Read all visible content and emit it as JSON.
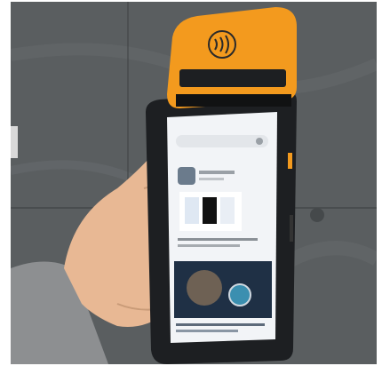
{
  "photo": {
    "subject": "handheld-pos-terminal",
    "colors": {
      "printer_orange": "#f39a1e",
      "device_body": "#1d1f22",
      "wall_tile": "#5a5e60",
      "skin": "#e8b894",
      "sleeve": "#8d8f91"
    }
  },
  "screen": {
    "search_placeholder": "",
    "app_title": "",
    "article_caption": "",
    "article_source": ""
  }
}
